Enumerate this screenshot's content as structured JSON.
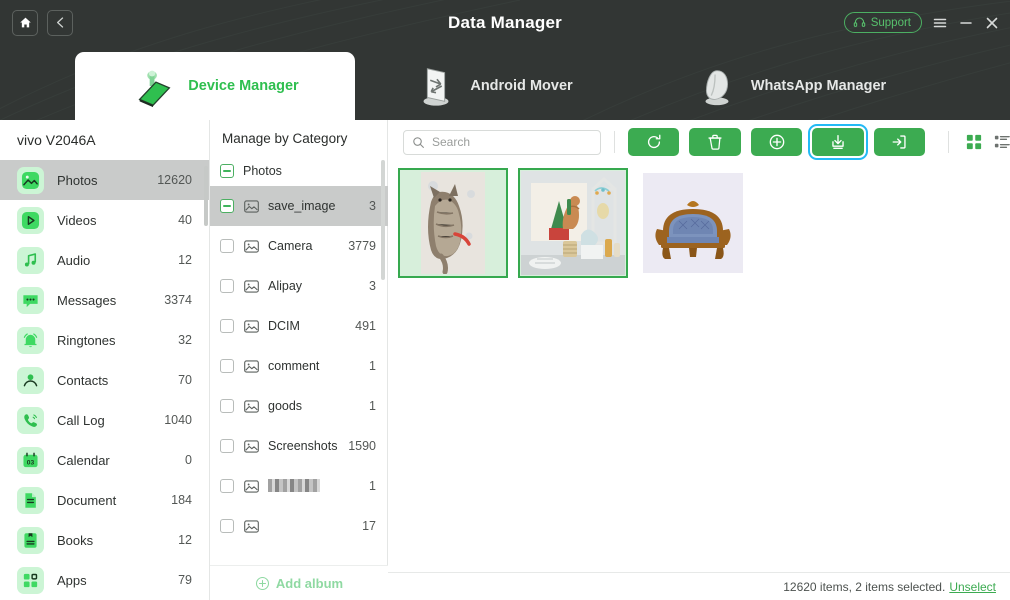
{
  "header": {
    "title": "Data Manager",
    "home_icon": "home-icon",
    "back_icon": "chevron-left-icon",
    "support_label": "Support",
    "support_icon": "headset-icon",
    "menu_icon": "hamburger-menu-icon",
    "minimize_icon": "minimize-icon",
    "close_icon": "close-icon",
    "background_color": "#323634"
  },
  "tabs": [
    {
      "label": "Device Manager",
      "icon": "device-manager-icon",
      "active": true
    },
    {
      "label": "Android Mover",
      "icon": "android-mover-icon",
      "active": false
    },
    {
      "label": "WhatsApp Manager",
      "icon": "whatsapp-manager-icon",
      "active": false
    }
  ],
  "sidebar": {
    "device_name": "vivo V2046A",
    "items": [
      {
        "label": "Photos",
        "count": "12620",
        "icon": "photos-icon",
        "selected": true
      },
      {
        "label": "Videos",
        "count": "40",
        "icon": "videos-icon",
        "selected": false
      },
      {
        "label": "Audio",
        "count": "12",
        "icon": "audio-icon",
        "selected": false
      },
      {
        "label": "Messages",
        "count": "3374",
        "icon": "messages-icon",
        "selected": false
      },
      {
        "label": "Ringtones",
        "count": "32",
        "icon": "ringtones-icon",
        "selected": false
      },
      {
        "label": "Contacts",
        "count": "70",
        "icon": "contacts-icon",
        "selected": false
      },
      {
        "label": "Call Log",
        "count": "1040",
        "icon": "calllog-icon",
        "selected": false
      },
      {
        "label": "Calendar",
        "count": "0",
        "icon": "calendar-icon",
        "selected": false
      },
      {
        "label": "Document",
        "count": "184",
        "icon": "document-icon",
        "selected": false
      },
      {
        "label": "Books",
        "count": "12",
        "icon": "books-icon",
        "selected": false
      },
      {
        "label": "Apps",
        "count": "79",
        "icon": "apps-icon",
        "selected": false
      }
    ]
  },
  "albums": {
    "header": "Manage by Category",
    "root": {
      "label": "Photos",
      "check_state": "indeterminate"
    },
    "items": [
      {
        "label": "save_image",
        "count": "3",
        "check_state": "indeterminate",
        "selected": true,
        "redacted": false
      },
      {
        "label": "Camera",
        "count": "3779",
        "check_state": "unchecked",
        "selected": false,
        "redacted": false
      },
      {
        "label": "Alipay",
        "count": "3",
        "check_state": "unchecked",
        "selected": false,
        "redacted": false
      },
      {
        "label": "DCIM",
        "count": "491",
        "check_state": "unchecked",
        "selected": false,
        "redacted": false
      },
      {
        "label": "comment",
        "count": "1",
        "check_state": "unchecked",
        "selected": false,
        "redacted": false
      },
      {
        "label": "goods",
        "count": "1",
        "check_state": "unchecked",
        "selected": false,
        "redacted": false
      },
      {
        "label": "Screenshots",
        "count": "1590",
        "check_state": "unchecked",
        "selected": false,
        "redacted": false
      },
      {
        "label": "",
        "count": "1",
        "check_state": "unchecked",
        "selected": false,
        "redacted": true
      },
      {
        "label": "",
        "count": "17",
        "check_state": "unchecked",
        "selected": false,
        "redacted": false
      }
    ],
    "add_album_label": "Add album",
    "add_album_icon": "plus-circle-icon"
  },
  "toolbar": {
    "search_placeholder": "Search",
    "search_value": "",
    "search_icon": "search-icon",
    "buttons": [
      {
        "name": "refresh-button",
        "icon": "refresh-icon",
        "focused": false
      },
      {
        "name": "delete-button",
        "icon": "trash-icon",
        "focused": false
      },
      {
        "name": "add-button",
        "icon": "plus-icon",
        "focused": false
      },
      {
        "name": "export-button",
        "icon": "download-icon",
        "focused": true
      },
      {
        "name": "import-button",
        "icon": "import-icon",
        "focused": false
      }
    ],
    "grid_view_icon": "grid-view-icon",
    "list_view_icon": "list-view-icon",
    "active_view": "grid",
    "accent_color": "#3cab51",
    "focus_color": "#24baf5"
  },
  "thumbnails": [
    {
      "name": "cat-on-bed-photo",
      "selected": true
    },
    {
      "name": "christmas-tapestry-photo",
      "selected": true
    },
    {
      "name": "blue-antique-sofa-photo",
      "selected": false
    }
  ],
  "statusbar": {
    "summary": "12620 items, 2 items selected.",
    "unselect_label": "Unselect"
  }
}
